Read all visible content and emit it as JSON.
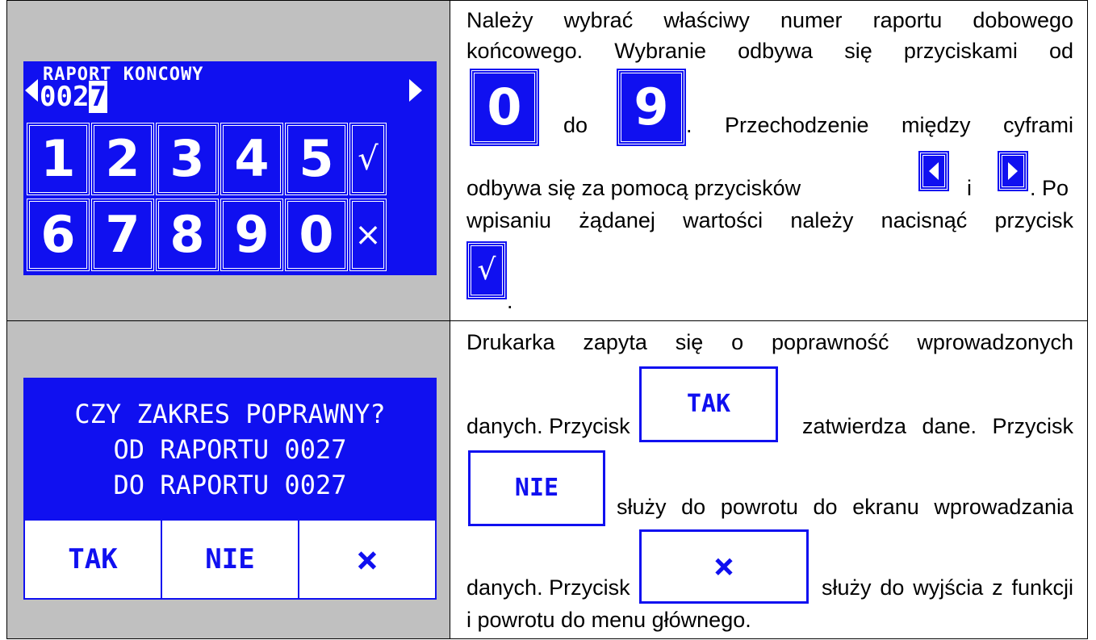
{
  "screen1": {
    "title": "RAPORT KONCOWY",
    "value_prefix": "002",
    "value_cursor": "7",
    "left_arrow": "◀",
    "right_arrow": "▶",
    "row1": [
      "1",
      "2",
      "3",
      "4",
      "5"
    ],
    "row2": [
      "6",
      "7",
      "8",
      "9",
      "0"
    ],
    "confirm": "√",
    "cancel": "×"
  },
  "text1": {
    "l1": "Należy wybrać właściwy numer raportu dobowego",
    "l2": "końcowego. Wybranie  odbywa się przyciskami od",
    "key_from": "0",
    "do": "do",
    "key_to": "9",
    "l3": ". Przechodzenie między cyframi",
    "l4a": "odbywa się za pomocą przycisków",
    "l4i": "i",
    "l4b": ". Po",
    "l5": "wpisaniu żądanej wartości należy nacisnąć przycisk",
    "confirm_icon": "√",
    "end": "."
  },
  "screen2": {
    "line1": "CZY ZAKRES POPRAWNY?",
    "line2": "OD RAPORTU 0027",
    "line3": "DO RAPORTU 0027",
    "btn_yes": "TAK",
    "btn_no": "NIE",
    "btn_x": "×"
  },
  "text2": {
    "l1": "Drukarka zapyta się o poprawność wprowadzonych",
    "l2a": "danych. Przycisk",
    "btn_yes": "TAK",
    "l2b": "zatwierdza dane. Przycisk",
    "btn_no": "NIE",
    "l3b": "służy do powrotu do ekranu wprowadzania",
    "l4a": "danych. Przycisk",
    "btn_x": "×",
    "l4b": "służy do wyjścia z funkcji",
    "l5": "i powrotu do menu głównego."
  },
  "colors": {
    "lcd_blue": "#1010f0",
    "cell_gray": "#c0c0c0"
  }
}
